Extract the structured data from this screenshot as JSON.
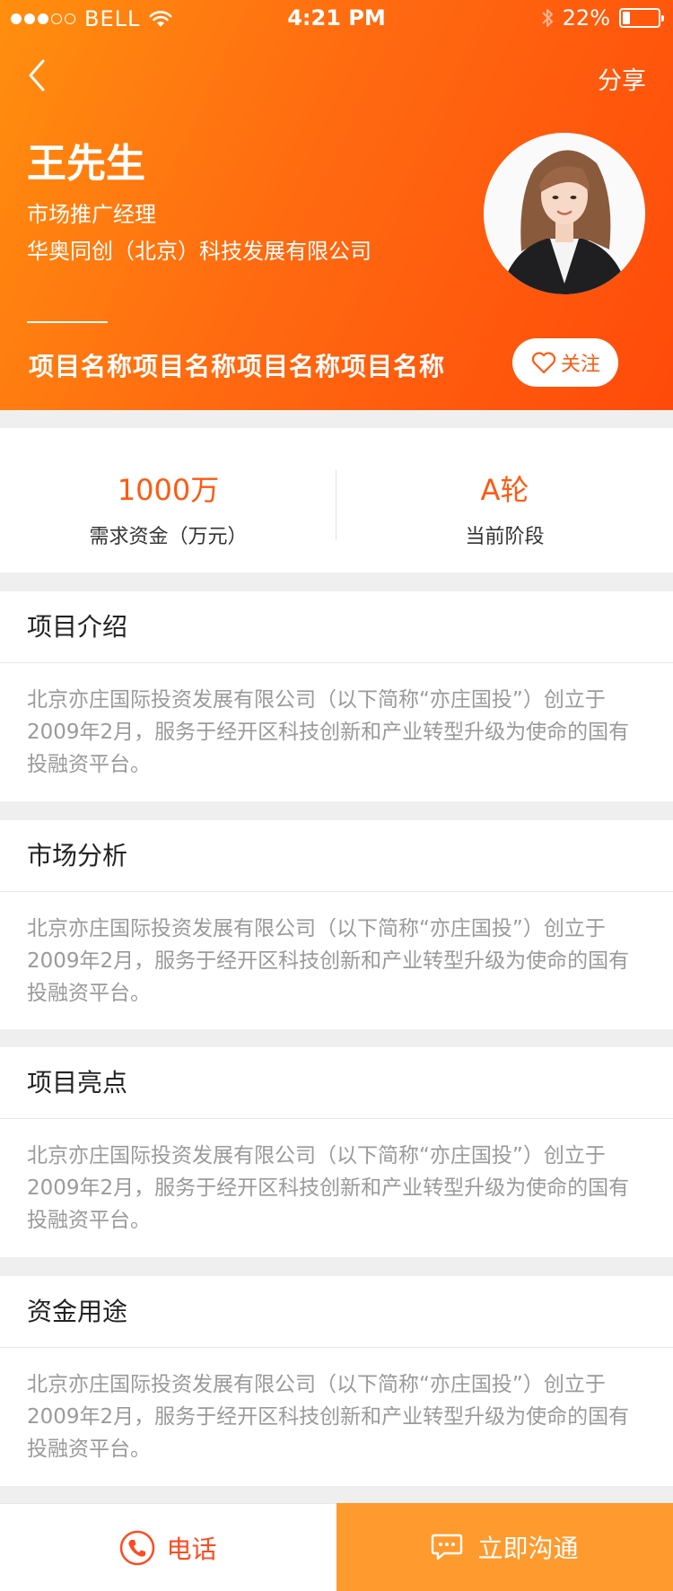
{
  "status_bar": {
    "carrier": "BELL",
    "time": "4:21 PM",
    "battery_text": "22%",
    "battery_level": 0.22,
    "signal_dots_filled": 3,
    "signal_dots_total": 5
  },
  "nav": {
    "back_icon": "chevron-left-icon",
    "share_label": "分享"
  },
  "profile": {
    "name": "王先生",
    "position": "市场推广经理",
    "company": "华奥同创（北京）科技发展有限公司",
    "project_name": "项目名称项目名称项目名称项目名称",
    "follow_label": "关注"
  },
  "stats": [
    {
      "value": "1000万",
      "label": "需求资金（万元）"
    },
    {
      "value": "A轮",
      "label": "当前阶段"
    }
  ],
  "sections": [
    {
      "title": "项目介绍",
      "body": "北京亦庄国际投资发展有限公司（以下简称“亦庄国投”）创立于2009年2月，服务于经开区科技创新和产业转型升级为使命的国有投融资平台。"
    },
    {
      "title": "市场分析",
      "body": "北京亦庄国际投资发展有限公司（以下简称“亦庄国投”）创立于2009年2月，服务于经开区科技创新和产业转型升级为使命的国有投融资平台。"
    },
    {
      "title": "项目亮点",
      "body": "北京亦庄国际投资发展有限公司（以下简称“亦庄国投”）创立于2009年2月，服务于经开区科技创新和产业转型升级为使命的国有投融资平台。"
    },
    {
      "title": "资金用途",
      "body": "北京亦庄国际投资发展有限公司（以下简称“亦庄国投”）创立于2009年2月，服务于经开区科技创新和产业转型升级为使命的国有投融资平台。"
    }
  ],
  "bottom": {
    "call_label": "电话",
    "chat_label": "立即沟通"
  },
  "colors": {
    "accent": "#ff5a12",
    "header_gradient_start": "#ff8f0f",
    "header_gradient_end": "#ff4a0a",
    "chat_button": "#ff9a2e",
    "body_text": "#9a9a9a"
  }
}
